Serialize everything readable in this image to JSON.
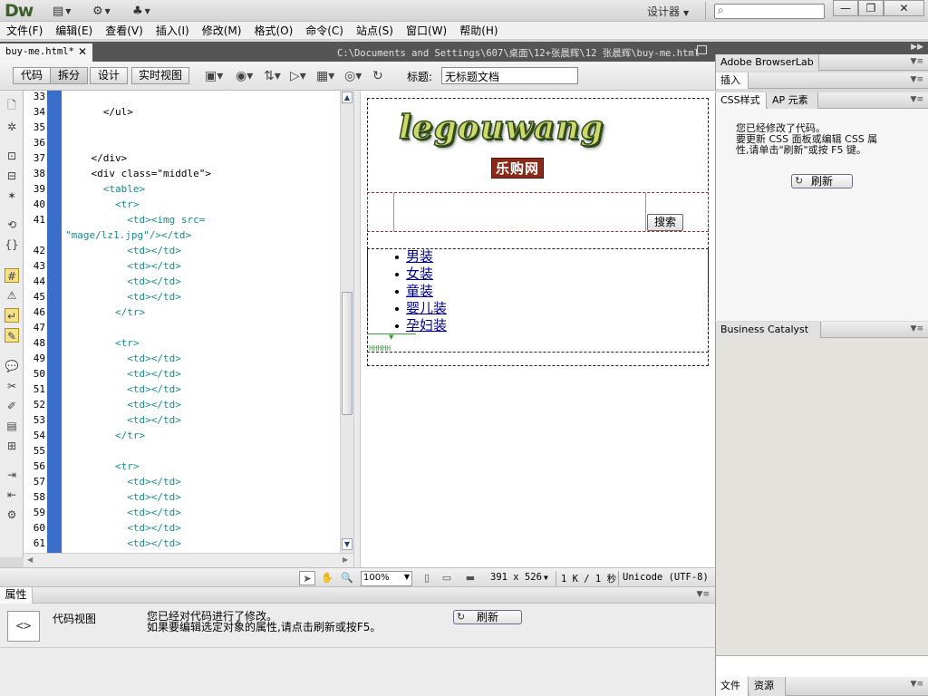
{
  "app": {
    "logo": "Dw",
    "workspace": "设计器",
    "search_placeholder": ""
  },
  "window_buttons": {
    "minimize": "—",
    "restore": "❐",
    "close": "✕"
  },
  "menu": [
    "文件(F)",
    "编辑(E)",
    "查看(V)",
    "插入(I)",
    "修改(M)",
    "格式(O)",
    "命令(C)",
    "站点(S)",
    "窗口(W)",
    "帮助(H)"
  ],
  "document": {
    "tab_label": "buy-me.html*",
    "path": "C:\\Documents and Settings\\607\\桌面\\12+张晨辉\\12 张晨辉\\buy-me.html",
    "title_label": "标题:",
    "title_value": "无标题文档"
  },
  "view_buttons": [
    "代码",
    "拆分",
    "设计",
    "实时视图"
  ],
  "code": {
    "lines": [
      {
        "n": "33",
        "text": ""
      },
      {
        "n": "34",
        "text": "      </ul>"
      },
      {
        "n": "35",
        "text": ""
      },
      {
        "n": "36",
        "text": ""
      },
      {
        "n": "37",
        "text": "    </div>"
      },
      {
        "n": "38",
        "text": "    <div class=\"middle\">"
      },
      {
        "n": "39",
        "text": "      <table>"
      },
      {
        "n": "40",
        "text": "        <tr>"
      },
      {
        "n": "41",
        "text": "          <td><img src="
      },
      {
        "n": "",
        "text": "\"mage/lz1.jpg\"/></td>"
      },
      {
        "n": "42",
        "text": "          <td></td>"
      },
      {
        "n": "43",
        "text": "          <td></td>"
      },
      {
        "n": "44",
        "text": "          <td></td>"
      },
      {
        "n": "45",
        "text": "          <td></td>"
      },
      {
        "n": "46",
        "text": "        </tr>"
      },
      {
        "n": "47",
        "text": ""
      },
      {
        "n": "48",
        "text": "        <tr>"
      },
      {
        "n": "49",
        "text": "          <td></td>"
      },
      {
        "n": "50",
        "text": "          <td></td>"
      },
      {
        "n": "51",
        "text": "          <td></td>"
      },
      {
        "n": "52",
        "text": "          <td></td>"
      },
      {
        "n": "53",
        "text": "          <td></td>"
      },
      {
        "n": "54",
        "text": "        </tr>"
      },
      {
        "n": "55",
        "text": ""
      },
      {
        "n": "56",
        "text": "        <tr>"
      },
      {
        "n": "57",
        "text": "          <td></td>"
      },
      {
        "n": "58",
        "text": "          <td></td>"
      },
      {
        "n": "59",
        "text": "          <td></td>"
      },
      {
        "n": "60",
        "text": "          <td></td>"
      },
      {
        "n": "61",
        "text": "          <td></td>"
      }
    ]
  },
  "design": {
    "logo_text": "legouwang",
    "logo_sub": "乐购网",
    "search_button": "搜索",
    "nav_items": [
      "男装",
      "女装",
      "童装",
      "婴儿装",
      "孕妇装"
    ]
  },
  "status": {
    "zoom": "100%",
    "size": "391 x 526",
    "weight": "1 K / 1 秒",
    "encoding": "Unicode (UTF-8)"
  },
  "properties": {
    "tab": "属性",
    "label": "代码视图",
    "message_line1": "您已经对代码进行了修改。",
    "message_line2": "如果要编辑选定对象的属性,请点击刷新或按F5。",
    "refresh": "刷新"
  },
  "right_panels": {
    "browserlab": "Adobe BrowserLab",
    "insert": "插入",
    "css_tab": "CSS样式",
    "ap_tab": "AP 元素",
    "css_msg_1": "您已经修改了代码。",
    "css_msg_2": "要更新 CSS 面板或编辑 CSS 属",
    "css_msg_3": "性,请单击\"刷新\"或按 F5 键。",
    "css_refresh": "刷新",
    "business": "Business Catalyst",
    "files_tab": "文件",
    "assets_tab": "资源"
  }
}
